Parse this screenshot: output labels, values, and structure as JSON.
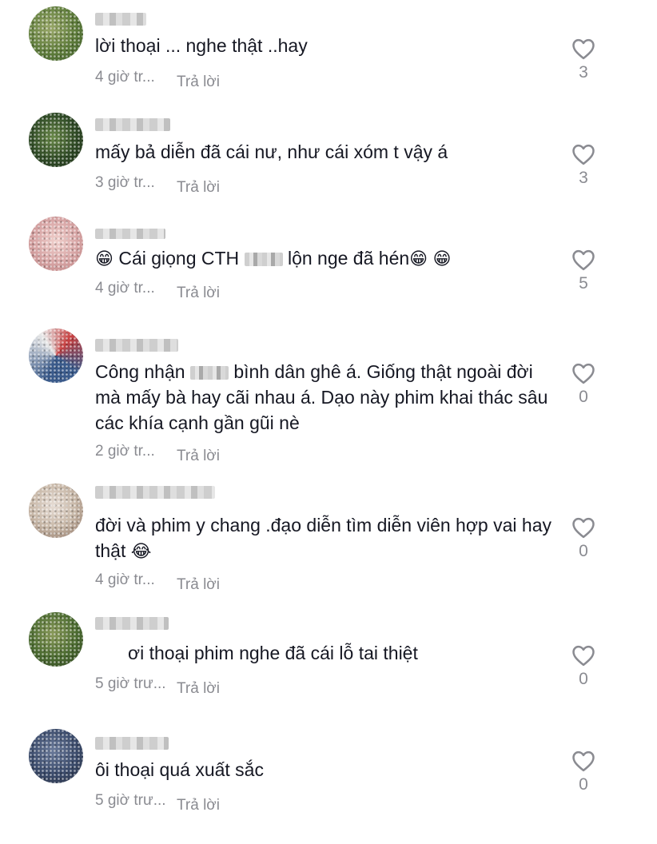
{
  "comments": [
    {
      "text": "lời thoại ... nghe thật ..hay",
      "time": "4 giờ tr...",
      "reply": "Trả lời",
      "likes": "3",
      "avatar_colors": [
        "#5d7b3a",
        "#9aa86a",
        "#3c5a2a"
      ]
    },
    {
      "text": "mấy bả diễn đã cái nư, như cái xóm t vậy á",
      "time": "3 giờ tr...",
      "reply": "Trả lời",
      "likes": "3",
      "avatar_colors": [
        "#2f4a26",
        "#6b8a4a",
        "#1e2d18"
      ]
    },
    {
      "text_before": "Cái giọng CTH",
      "text_after": "lộn nge đã hén",
      "emoji": "😁",
      "time": "4 giờ tr...",
      "reply": "Trả lời",
      "likes": "5",
      "avatar_colors": [
        "#d9a8a8",
        "#b87a7a",
        "#f0d0cc"
      ]
    },
    {
      "text_before": "Công nhận",
      "text_after": "bình dân ghê á. Giống thật ngoài đời mà mấy bà hay cãi nhau á. Dạo này phim khai thác sâu các khía cạnh gần gũi nè",
      "time": "2 giờ tr...",
      "reply": "Trả lời",
      "likes": "0",
      "avatar_colors": [
        "#3a5a8a",
        "#c84040",
        "#e8e8e8"
      ]
    },
    {
      "text": "đời và phim y chang .đạo diễn tìm diễn viên hợp vai hay thật",
      "emoji": "😂",
      "time": "4 giờ tr...",
      "reply": "Trả lời",
      "likes": "0",
      "avatar_colors": [
        "#c8b8a8",
        "#8a7060",
        "#e6dcd4"
      ]
    },
    {
      "text": "ơi thoại phim nghe đã cái lỗ tai thiệt",
      "time": "5 giờ trư...",
      "reply": "Trả lời",
      "likes": "0",
      "avatar_colors": [
        "#4a6a30",
        "#8a9a5a",
        "#2e4020"
      ]
    },
    {
      "text": "ôi thoại quá xuất sắc",
      "time": "5 giờ trư...",
      "reply": "Trả lời",
      "likes": "0",
      "avatar_colors": [
        "#3a4a6a",
        "#6a7a9a",
        "#2a3040"
      ]
    }
  ]
}
